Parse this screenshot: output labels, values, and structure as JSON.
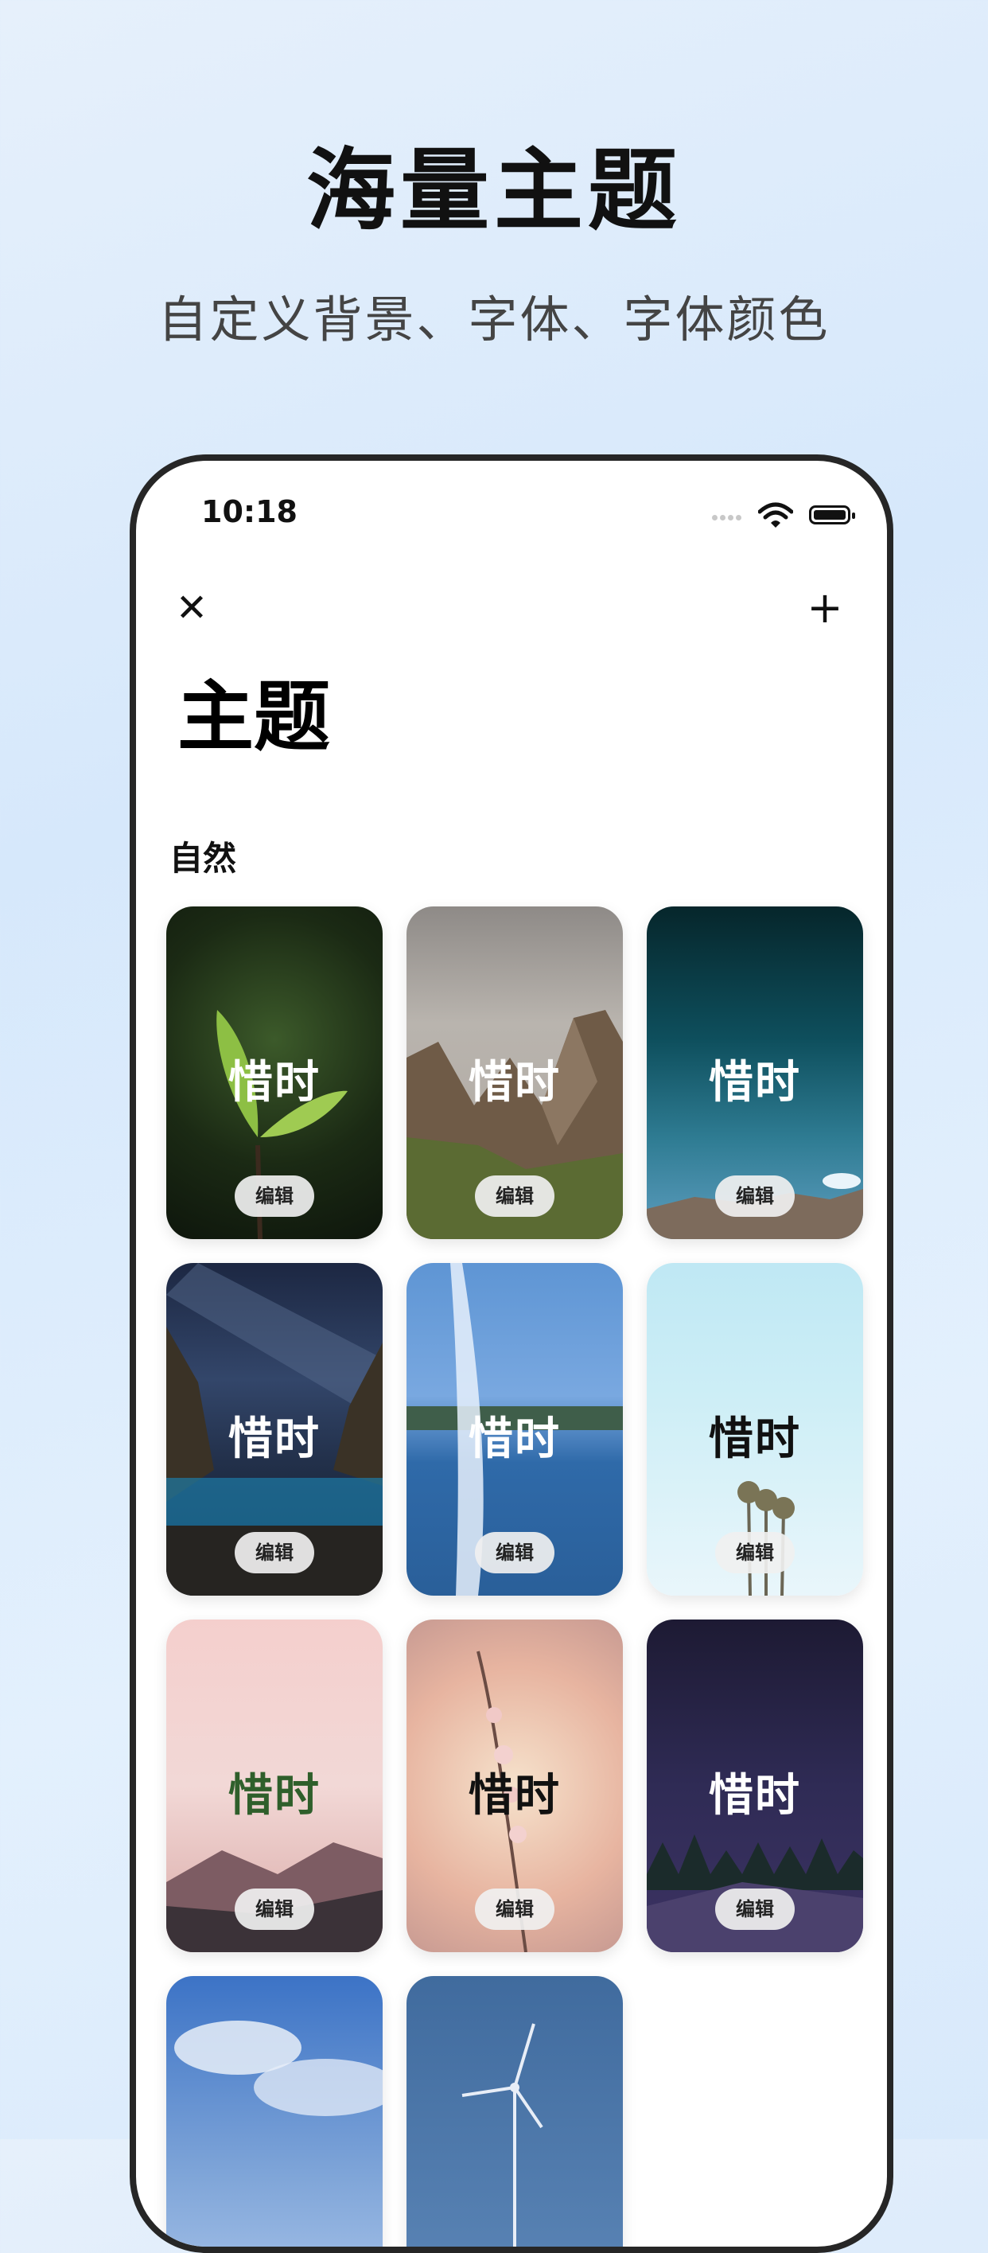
{
  "hero": {
    "title": "海量主题",
    "subtitle": "自定义背景、字体、字体颜色"
  },
  "status_bar": {
    "time": "10:18"
  },
  "nav": {
    "close_icon": "close-icon",
    "add_icon": "plus-icon"
  },
  "page": {
    "title": "主题",
    "section": "自然"
  },
  "themes": [
    {
      "label": "惜时",
      "edit": "编辑",
      "text_color": "#ffffff",
      "bg": "leaf"
    },
    {
      "label": "惜时",
      "edit": "编辑",
      "text_color": "#ffffff",
      "bg": "mountains"
    },
    {
      "label": "惜时",
      "edit": "编辑",
      "text_color": "#ffffff",
      "bg": "teal-sky"
    },
    {
      "label": "惜时",
      "edit": "编辑",
      "text_color": "#ffffff",
      "bg": "milky-way"
    },
    {
      "label": "惜时",
      "edit": "编辑",
      "text_color": "#ffffff",
      "bg": "fountain"
    },
    {
      "label": "惜时",
      "edit": "编辑",
      "text_color": "#111111",
      "bg": "palm-sky"
    },
    {
      "label": "惜时",
      "edit": "编辑",
      "text_color": "#2f5f2b",
      "bg": "pink-mountain"
    },
    {
      "label": "惜时",
      "edit": "编辑",
      "text_color": "#111111",
      "bg": "blossom"
    },
    {
      "label": "惜时",
      "edit": "编辑",
      "text_color": "#ffffff",
      "bg": "night-forest"
    },
    {
      "bg": "clouds"
    },
    {
      "bg": "windmill"
    }
  ]
}
